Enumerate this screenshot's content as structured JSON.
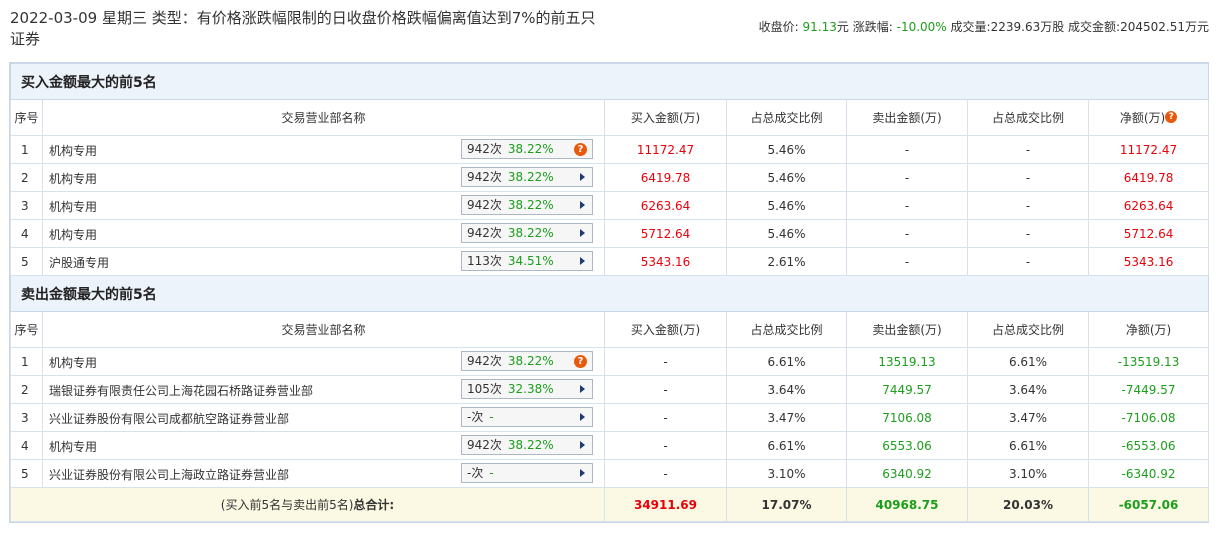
{
  "header": {
    "title": "2022-03-09 星期三 类型：有价格涨跌幅限制的日收盘价格跌幅偏离值达到7%的前五只证券",
    "close_label": "收盘价:",
    "close_value": "91.13",
    "close_unit": "元",
    "change_label": "涨跌幅:",
    "change_value": "-10.00%",
    "volume_label": "成交量:",
    "volume_value": "2239.63万股",
    "amount_label": "成交金额:",
    "amount_value": "204502.51万元"
  },
  "columns": {
    "idx": "序号",
    "dept": "交易营业部名称",
    "buy": "买入金额(万)",
    "buy_ratio": "占总成交比例",
    "sell": "卖出金额(万)",
    "sell_ratio": "占总成交比例",
    "net": "净额(万)"
  },
  "buy_section": {
    "title": "买入金额最大的前5名",
    "rows": [
      {
        "idx": "1",
        "name": "机构专用",
        "count": "942次",
        "pct": "38.22%",
        "icon": "question-icon",
        "buy": "11172.47",
        "buy_ratio": "5.46%",
        "sell": "-",
        "sell_ratio": "-",
        "net": "11172.47"
      },
      {
        "idx": "2",
        "name": "机构专用",
        "count": "942次",
        "pct": "38.22%",
        "icon": "arrow-right-icon",
        "buy": "6419.78",
        "buy_ratio": "5.46%",
        "sell": "-",
        "sell_ratio": "-",
        "net": "6419.78"
      },
      {
        "idx": "3",
        "name": "机构专用",
        "count": "942次",
        "pct": "38.22%",
        "icon": "arrow-right-icon",
        "buy": "6263.64",
        "buy_ratio": "5.46%",
        "sell": "-",
        "sell_ratio": "-",
        "net": "6263.64"
      },
      {
        "idx": "4",
        "name": "机构专用",
        "count": "942次",
        "pct": "38.22%",
        "icon": "arrow-right-icon",
        "buy": "5712.64",
        "buy_ratio": "5.46%",
        "sell": "-",
        "sell_ratio": "-",
        "net": "5712.64"
      },
      {
        "idx": "5",
        "name": "沪股通专用",
        "count": "113次",
        "pct": "34.51%",
        "icon": "arrow-right-icon",
        "buy": "5343.16",
        "buy_ratio": "2.61%",
        "sell": "-",
        "sell_ratio": "-",
        "net": "5343.16"
      }
    ]
  },
  "sell_section": {
    "title": "卖出金额最大的前5名",
    "rows": [
      {
        "idx": "1",
        "name": "机构专用",
        "count": "942次",
        "pct": "38.22%",
        "icon": "question-icon",
        "buy": "-",
        "buy_ratio": "6.61%",
        "sell": "13519.13",
        "sell_ratio": "6.61%",
        "net": "-13519.13"
      },
      {
        "idx": "2",
        "name": "瑞银证券有限责任公司上海花园石桥路证券营业部",
        "count": "105次",
        "pct": "32.38%",
        "icon": "arrow-right-icon",
        "buy": "-",
        "buy_ratio": "3.64%",
        "sell": "7449.57",
        "sell_ratio": "3.64%",
        "net": "-7449.57"
      },
      {
        "idx": "3",
        "name": "兴业证券股份有限公司成都航空路证券营业部",
        "count": "-次",
        "pct": "-",
        "icon": "arrow-right-icon",
        "buy": "-",
        "buy_ratio": "3.47%",
        "sell": "7106.08",
        "sell_ratio": "3.47%",
        "net": "-7106.08"
      },
      {
        "idx": "4",
        "name": "机构专用",
        "count": "942次",
        "pct": "38.22%",
        "icon": "arrow-right-icon",
        "buy": "-",
        "buy_ratio": "6.61%",
        "sell": "6553.06",
        "sell_ratio": "6.61%",
        "net": "-6553.06"
      },
      {
        "idx": "5",
        "name": "兴业证券股份有限公司上海政立路证券营业部",
        "count": "-次",
        "pct": "-",
        "icon": "arrow-right-icon",
        "buy": "-",
        "buy_ratio": "3.10%",
        "sell": "6340.92",
        "sell_ratio": "3.10%",
        "net": "-6340.92"
      }
    ]
  },
  "total": {
    "label_prefix": "(买入前5名与卖出前5名)",
    "label_bold": "总合计:",
    "buy": "34911.69",
    "buy_ratio": "17.07%",
    "sell": "40968.75",
    "sell_ratio": "20.03%",
    "net": "-6057.06"
  },
  "colors": {
    "up": "#e8000b",
    "down": "#1c9e1c",
    "section_bg": "#edf3fa",
    "total_bg": "#fbf9e3"
  }
}
